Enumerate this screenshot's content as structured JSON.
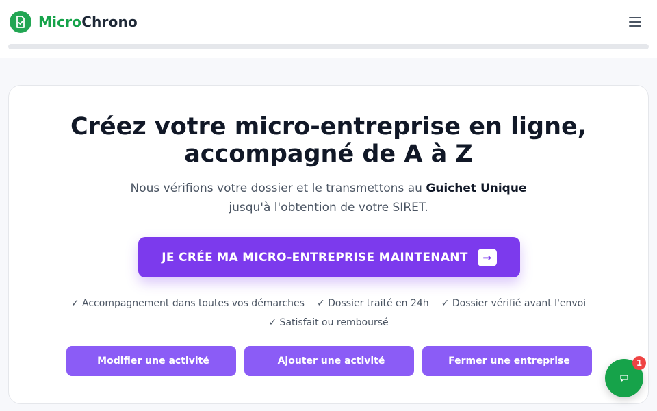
{
  "header": {
    "brand_part1": "Micro",
    "brand_part2": "Chrono",
    "logo_icon": "document-check-icon",
    "menu_icon": "hamburger-menu-icon",
    "progress_fraction": 0.0,
    "colors": {
      "brand_green": "#16a34a",
      "accent_purple": "#7c3aed"
    }
  },
  "hero": {
    "title": "Créez votre micro-entreprise en ligne, accompagné de A à Z",
    "subtitle_part1": "Nous vérifions votre dossier et le transmettons au",
    "subtitle_bold": "Guichet Unique",
    "subtitle_part2": "jusqu'à l'obtention de votre SIRET.",
    "cta_label": "JE CRÉE MA MICRO-ENTREPRISE MAINTENANT",
    "cta_arrow": "→"
  },
  "features": [
    "✓ Accompagnement dans toutes vos démarches",
    "✓ Dossier traité en 24h",
    "✓ Dossier vérifié avant l'envoi",
    "✓ Satisfait ou remboursé"
  ],
  "actions": [
    {
      "icon": "",
      "label": "Modifier une activité"
    },
    {
      "icon": "",
      "label": "Ajouter une activité"
    },
    {
      "icon": "",
      "label": "Fermer une entreprise"
    }
  ],
  "chat": {
    "icon": "chat-bubble-icon",
    "badge_count": "1"
  }
}
